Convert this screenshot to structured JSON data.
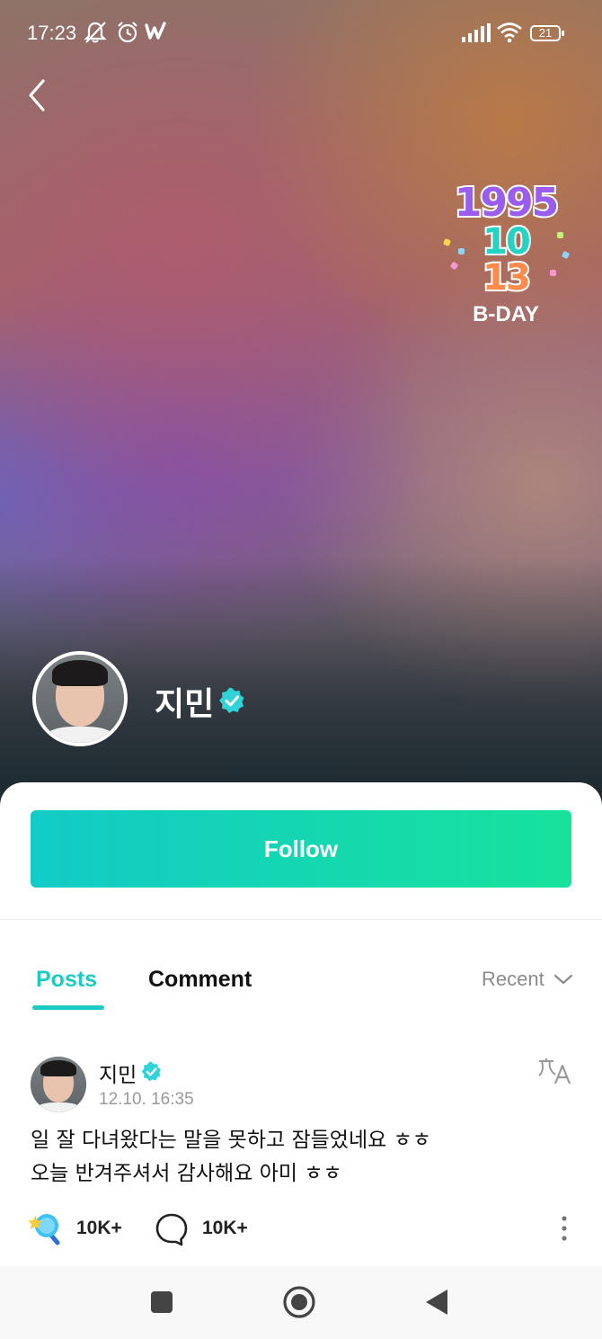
{
  "status_bar": {
    "time": "17:23",
    "battery": "21",
    "icons": [
      "mute-bell-icon",
      "alarm-icon",
      "weverse-icon",
      "signal-icon",
      "wifi-icon",
      "battery-icon"
    ]
  },
  "header": {
    "back_icon": "chevron-left-icon"
  },
  "birthday_badge": {
    "year": "1995",
    "month": "10",
    "day": "13",
    "label": "B-DAY"
  },
  "profile": {
    "name": "지민",
    "verified": true,
    "avatar_icon": "avatar"
  },
  "actions": {
    "follow_label": "Follow"
  },
  "tabs": {
    "items": [
      {
        "label": "Posts",
        "active": true
      },
      {
        "label": "Comment",
        "active": false
      }
    ],
    "sort_label": "Recent"
  },
  "posts": [
    {
      "author": "지민",
      "verified": true,
      "timestamp": "12.10. 16:35",
      "lines": [
        "일 잘 다녀왔다는 말을 못하고 잠들었네요 ㅎㅎ",
        "오늘 반겨주셔서 감사해요 아미 ㅎㅎ"
      ],
      "likes": "10K+",
      "comments": "10K+"
    }
  ],
  "colors": {
    "accent": "#1ccbc4",
    "follow_gradient_start": "#12cbc7",
    "follow_gradient_end": "#17e29b"
  }
}
